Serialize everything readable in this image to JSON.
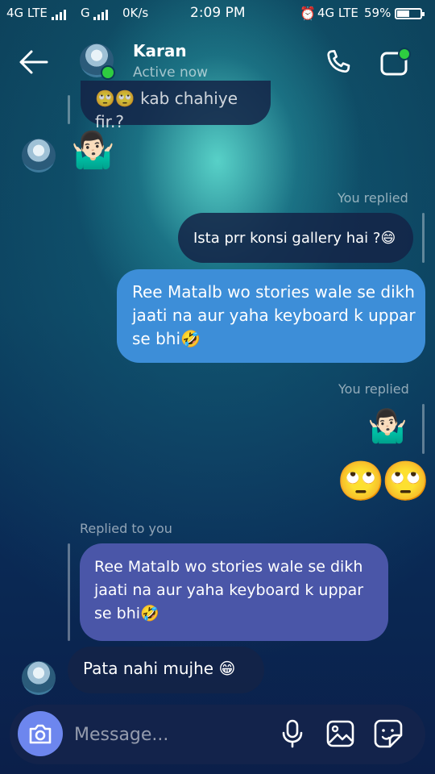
{
  "status_bar": {
    "network1": "4G LTE",
    "network2": "G",
    "speed": "0K/s",
    "time": "2:09 PM",
    "network3": "4G LTE",
    "battery": "59%",
    "battery_level": 0.59
  },
  "header": {
    "back_icon": "arrow-left-icon",
    "contact_name": "Karan",
    "status": "Active now",
    "call_icon": "phone-icon",
    "video_icon": "video-camera-icon"
  },
  "messages": {
    "partial_top": "🙄🙄 kab chahiye fir.?",
    "received_emoji_1": "🤷🏻‍♂️",
    "you_replied_1": "You replied",
    "quoted_1": "Ista prr konsi gallery hai ?😄",
    "sent_1": "Ree Matalb wo stories wale se dikh jaati na aur yaha keyboard k uppar se bhi🤣",
    "you_replied_2": "You replied",
    "quoted_2_emoji": "🤷🏻‍♂️",
    "sent_emoji": "🙄🙄",
    "replied_to_you": "Replied to you",
    "quoted_3": "Ree Matalb wo stories wale se dikh jaati na aur yaha keyboard k uppar se bhi🤣",
    "received_1": "Pata nahi mujhe 😁"
  },
  "composer": {
    "placeholder": "Message...",
    "camera_icon": "camera-icon",
    "mic_icon": "microphone-icon",
    "gallery_icon": "image-icon",
    "sticker_icon": "sticker-icon"
  },
  "colors": {
    "sent_bubble": "#3d8ed8",
    "received_bubble": "#4a56a8",
    "quoted_bubble": "#14234a",
    "camera_button": "#6d86ee",
    "online_dot": "#2ecc40"
  }
}
